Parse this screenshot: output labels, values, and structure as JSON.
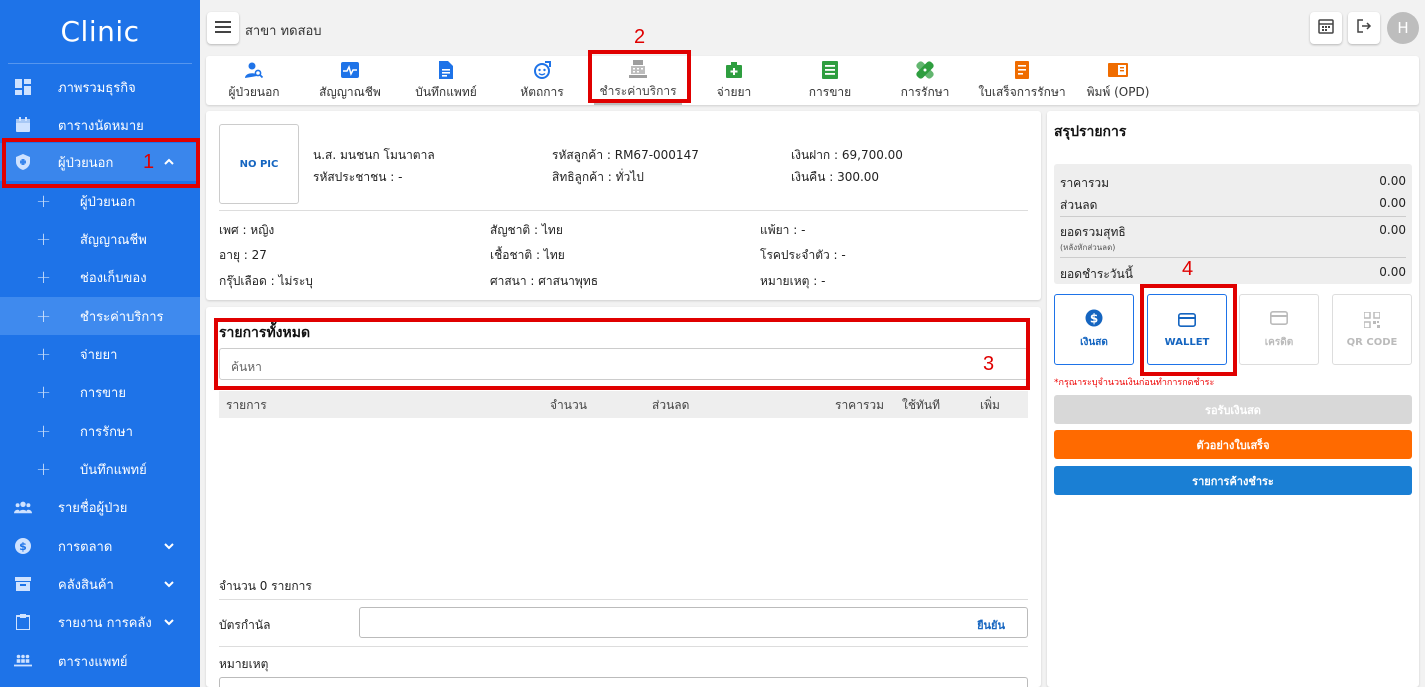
{
  "app": {
    "brand": "Clinic",
    "branch": "สาขา ทดสอบ",
    "avatar_initial": "H"
  },
  "sidebar": {
    "items": [
      {
        "label": "ภาพรวมธุรกิจ",
        "icon": "dashboard-icon"
      },
      {
        "label": "ตารางนัดหมาย",
        "icon": "calendar-icon"
      },
      {
        "label": "ผู้ป่วยนอก",
        "icon": "shield-icon"
      },
      {
        "label": "ผู้ป่วยนอก"
      },
      {
        "label": "สัญญาณชีพ"
      },
      {
        "label": "ช่องเก็บของ"
      },
      {
        "label": "ชำระค่าบริการ"
      },
      {
        "label": "จ่ายยา"
      },
      {
        "label": "การขาย"
      },
      {
        "label": "การรักษา"
      },
      {
        "label": "บันทึกแพทย์"
      },
      {
        "label": "รายชื่อผู้ป่วย",
        "icon": "people-icon"
      },
      {
        "label": "การตลาด",
        "icon": "dollar-icon"
      },
      {
        "label": "คลังสินค้า",
        "icon": "archive-icon"
      },
      {
        "label": "รายงาน การคลัง",
        "icon": "clipboard-icon"
      },
      {
        "label": "ตารางแพทย์",
        "icon": "doctors-icon"
      }
    ]
  },
  "tabs": [
    {
      "label": "ผู้ป่วยนอก",
      "icon": "patient-search-icon"
    },
    {
      "label": "สัญญาณชีพ",
      "icon": "vitals-icon"
    },
    {
      "label": "บันทึกแพทย์",
      "icon": "document-icon"
    },
    {
      "label": "หัตถการ",
      "icon": "procedure-icon"
    },
    {
      "label": "ชำระค่าบริการ",
      "icon": "cash-register-icon"
    },
    {
      "label": "จ่ายยา",
      "icon": "medicine-icon"
    },
    {
      "label": "การขาย",
      "icon": "sales-list-icon"
    },
    {
      "label": "การรักษา",
      "icon": "bandage-icon"
    },
    {
      "label": "ใบเสร็จการรักษา",
      "icon": "receipt-icon"
    },
    {
      "label": "พิมพ์ (OPD)",
      "icon": "print-book-icon"
    }
  ],
  "patient": {
    "no_pic": "NO PIC",
    "name": "น.ส. มนชนก โมนาตาล",
    "citizen_id": "รหัสประชาชน : -",
    "customer_code": "รหัสลูกค้า : RM67-000147",
    "customer_right": "สิทธิลูกค้า : ทั่วไป",
    "deposit": "เงินฝาก : 69,700.00",
    "refund": "เงินคืน : 300.00",
    "gender": "เพศ : หญิง",
    "age": "อายุ : 27",
    "blood": "กรุ๊ปเลือด : ไม่ระบุ",
    "nationality": "สัญชาติ : ไทย",
    "race": "เชื้อชาติ : ไทย",
    "religion": "ศาสนา : ศาสนาพุทธ",
    "allergy": "แพ้ยา : -",
    "disease": "โรคประจำตัว : -",
    "remark": "หมายเหตุ : -"
  },
  "items": {
    "title": "รายการทั้งหมด",
    "search_placeholder": "ค้นหา",
    "columns": [
      "รายการ",
      "จำนวน",
      "ส่วนลด",
      "ราคารวม",
      "ใช้ทันที",
      "เพิ่ม"
    ],
    "count_text": "จำนวน 0 รายการ",
    "voucher_label": "บัตรกำนัล",
    "confirm_label": "ยืนยัน",
    "note_label": "หมายเหตุ"
  },
  "summary": {
    "title": "สรุปรายการ",
    "total_label": "ราคารวม",
    "total_value": "0.00",
    "discount_label": "ส่วนลด",
    "discount_value": "0.00",
    "net_label": "ยอดรวมสุทธิ",
    "net_sub": "(หลังหักส่วนลด)",
    "net_value": "0.00",
    "today_label": "ยอดชำระวันนี้",
    "today_value": "0.00",
    "payment_methods": [
      {
        "label": "เงินสด",
        "icon": "dollar-circle-icon",
        "enabled": true
      },
      {
        "label": "WALLET",
        "icon": "card-icon",
        "enabled": true
      },
      {
        "label": "เครดิต",
        "icon": "credit-card-icon",
        "enabled": false
      },
      {
        "label": "QR CODE",
        "icon": "qr-code-icon",
        "enabled": false
      }
    ],
    "warning": "*กรุณาระบุจำนวนเงินก่อนทำการกดชำระ",
    "receive_btn": "รอรับเงินสด",
    "preview_btn": "ตัวอย่างใบเสร็จ",
    "pending_btn": "รายการค้างชำระ"
  },
  "annotations": [
    "1",
    "2",
    "3",
    "4"
  ],
  "colors": {
    "primary": "#1e73e8",
    "orange": "#ff6a00",
    "blue_btn": "#1a7fd4",
    "highlight": "#e00000"
  }
}
